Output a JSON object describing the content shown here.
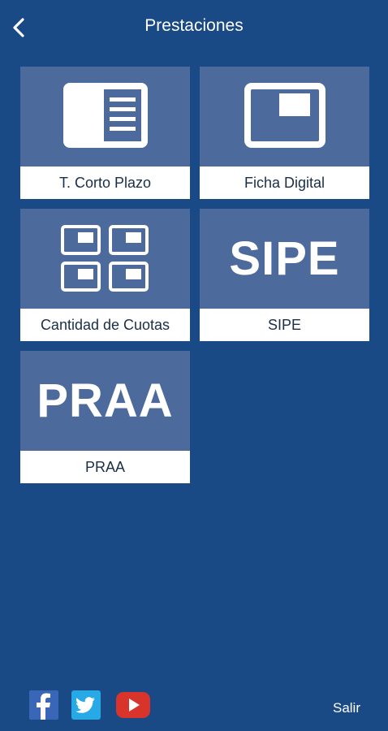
{
  "header": {
    "title": "Prestaciones",
    "back_icon": "chevron-left-icon"
  },
  "tiles": [
    {
      "label": "T. Corto Plazo",
      "icon": "card-with-list-icon"
    },
    {
      "label": "Ficha Digital",
      "icon": "card-with-badge-icon"
    },
    {
      "label": "Cantidad de Cuotas",
      "icon": "grid-of-cards-icon"
    },
    {
      "label": "SIPE",
      "icon_text": "SIPE"
    },
    {
      "label": "PRAA",
      "icon_text": "PRAA"
    }
  ],
  "footer": {
    "social": [
      "facebook-icon",
      "twitter-icon",
      "youtube-icon"
    ],
    "logout_label": "Salir"
  },
  "colors": {
    "background": "#1a4a86",
    "tile": "#4d6a9c",
    "label_bg": "#ffffff",
    "label_text": "#1a2e48"
  }
}
